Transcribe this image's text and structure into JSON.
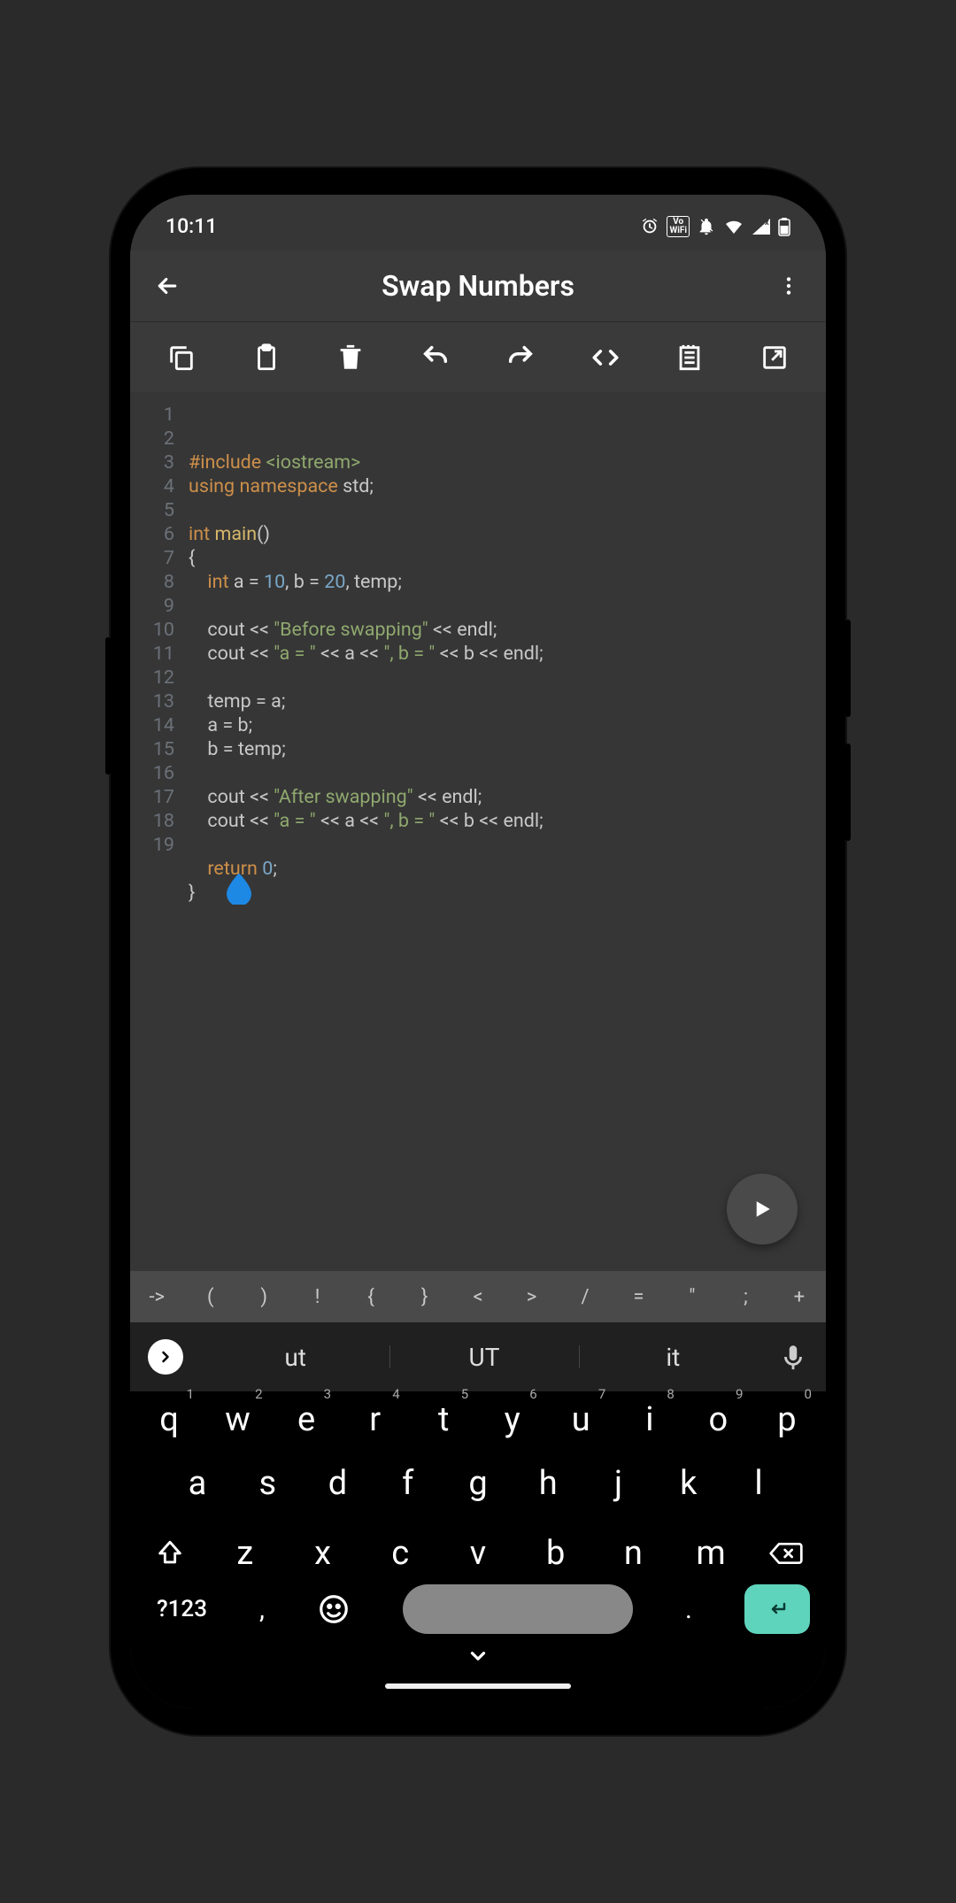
{
  "status": {
    "time": "10:11"
  },
  "header": {
    "title": "Swap Numbers"
  },
  "toolbar_icons": [
    "copy",
    "paste",
    "delete",
    "undo",
    "redo",
    "code-tags",
    "note",
    "open-external"
  ],
  "code": {
    "lines": [
      [
        {
          "t": "#include ",
          "c": "pre"
        },
        {
          "t": "<iostream>",
          "c": "inc"
        }
      ],
      [
        {
          "t": "using ",
          "c": "ns"
        },
        {
          "t": "namespace ",
          "c": "ns"
        },
        {
          "t": "std;",
          "c": "id"
        }
      ],
      [],
      [
        {
          "t": "int ",
          "c": "type"
        },
        {
          "t": "main",
          "c": "fn"
        },
        {
          "t": "()",
          "c": "id"
        }
      ],
      [
        {
          "t": "{",
          "c": "id"
        }
      ],
      [
        {
          "t": "    ",
          "c": "id"
        },
        {
          "t": "int ",
          "c": "type"
        },
        {
          "t": "a = ",
          "c": "id"
        },
        {
          "t": "10",
          "c": "num"
        },
        {
          "t": ", b = ",
          "c": "id"
        },
        {
          "t": "20",
          "c": "num"
        },
        {
          "t": ", temp;",
          "c": "id"
        }
      ],
      [],
      [
        {
          "t": "    cout << ",
          "c": "id"
        },
        {
          "t": "\"Before swapping\"",
          "c": "str"
        },
        {
          "t": " << endl;",
          "c": "id"
        }
      ],
      [
        {
          "t": "    cout << ",
          "c": "id"
        },
        {
          "t": "\"a = \"",
          "c": "str"
        },
        {
          "t": " << a << ",
          "c": "id"
        },
        {
          "t": "\", b = \"",
          "c": "str"
        },
        {
          "t": " << b << endl;",
          "c": "id"
        }
      ],
      [],
      [
        {
          "t": "    temp = a;",
          "c": "id"
        }
      ],
      [
        {
          "t": "    a = b;",
          "c": "id"
        }
      ],
      [
        {
          "t": "    b = temp;",
          "c": "id"
        }
      ],
      [],
      [
        {
          "t": "    cout << ",
          "c": "id"
        },
        {
          "t": "\"After swapping\"",
          "c": "str"
        },
        {
          "t": " << endl;",
          "c": "id"
        }
      ],
      [
        {
          "t": "    cout << ",
          "c": "id"
        },
        {
          "t": "\"a = \"",
          "c": "str"
        },
        {
          "t": " << a << ",
          "c": "id"
        },
        {
          "t": "\", b = \"",
          "c": "str"
        },
        {
          "t": " << b << endl;",
          "c": "id"
        }
      ],
      [],
      [
        {
          "t": "    ",
          "c": "id"
        },
        {
          "t": "return ",
          "c": "kw"
        },
        {
          "t": "0",
          "c": "num"
        },
        {
          "t": ";",
          "c": "id"
        }
      ],
      [
        {
          "t": "}",
          "c": "id"
        }
      ]
    ]
  },
  "symbol_row": [
    "->",
    "(",
    ")",
    "!",
    "{",
    "}",
    "<",
    ">",
    "/",
    "=",
    "\"",
    ";",
    "+"
  ],
  "suggestions": {
    "items": [
      "ut",
      "UT",
      "it"
    ]
  },
  "keyboard": {
    "row1": [
      [
        "q",
        "1"
      ],
      [
        "w",
        "2"
      ],
      [
        "e",
        "3"
      ],
      [
        "r",
        "4"
      ],
      [
        "t",
        "5"
      ],
      [
        "y",
        "6"
      ],
      [
        "u",
        "7"
      ],
      [
        "i",
        "8"
      ],
      [
        "o",
        "9"
      ],
      [
        "p",
        "0"
      ]
    ],
    "row2": [
      "a",
      "s",
      "d",
      "f",
      "g",
      "h",
      "j",
      "k",
      "l"
    ],
    "row3": [
      "z",
      "x",
      "c",
      "v",
      "b",
      "n",
      "m"
    ],
    "num_key": "?123",
    "comma": ",",
    "period": "."
  }
}
